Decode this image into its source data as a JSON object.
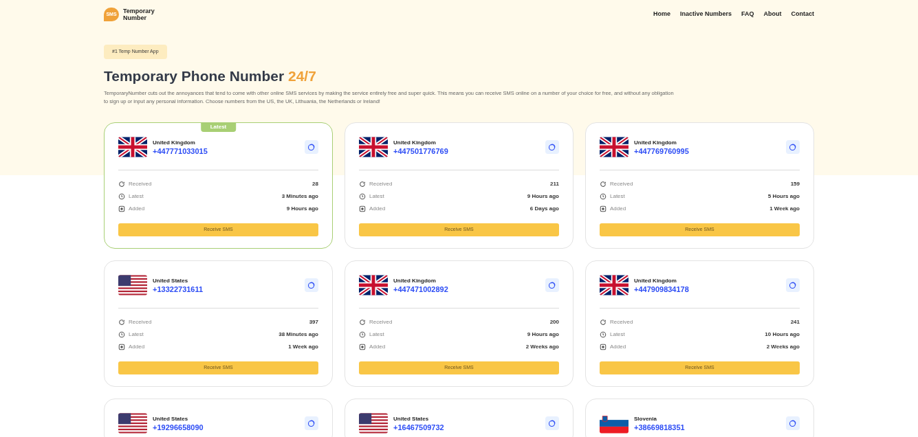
{
  "brand": {
    "logo_text": "SMS",
    "name": "Temporary Number"
  },
  "nav": [
    "Home",
    "Inactive Numbers",
    "FAQ",
    "About",
    "Contact"
  ],
  "hero": {
    "tag": "#1 Temp Number App",
    "title": "Temporary Phone Number",
    "title_accent": "24/7",
    "description": "TemporaryNumber cuts out the annoyances that tend to come with other online SMS services by making the service entirely free and super quick. This means you can receive SMS online on a number of your choice for free, and without any obligation to sign up or input any personal information. Choose numbers from the US, the UK, Lithuania, the Netherlands or Ireland!"
  },
  "cards": [
    {
      "kind": "uk",
      "country": "United Kingdom",
      "number": "+447771033015",
      "highlighted": true,
      "badge": "Latest",
      "stats": [
        {
          "kind": "received",
          "label": "Received",
          "value": "28"
        },
        {
          "kind": "latest",
          "label": "Latest",
          "value": "3 Minutes ago"
        },
        {
          "kind": "added",
          "label": "Added",
          "value": "9 Hours ago"
        }
      ],
      "button": "Receive SMS"
    },
    {
      "kind": "uk",
      "country": "United Kingdom",
      "number": "+447501776769",
      "highlighted": false,
      "stats": [
        {
          "kind": "received",
          "label": "Received",
          "value": "211"
        },
        {
          "kind": "latest",
          "label": "Latest",
          "value": "9 Hours ago"
        },
        {
          "kind": "added",
          "label": "Added",
          "value": "6 Days ago"
        }
      ],
      "button": "Receive SMS"
    },
    {
      "kind": "uk",
      "country": "United Kingdom",
      "number": "+447769760995",
      "highlighted": false,
      "stats": [
        {
          "kind": "received",
          "label": "Received",
          "value": "159"
        },
        {
          "kind": "latest",
          "label": "Latest",
          "value": "5 Hours ago"
        },
        {
          "kind": "added",
          "label": "Added",
          "value": "1 Week ago"
        }
      ],
      "button": "Receive SMS"
    },
    {
      "kind": "us",
      "country": "United States",
      "number": "+13322731611",
      "highlighted": false,
      "stats": [
        {
          "kind": "received",
          "label": "Received",
          "value": "397"
        },
        {
          "kind": "latest",
          "label": "Latest",
          "value": "38 Minutes ago"
        },
        {
          "kind": "added",
          "label": "Added",
          "value": "1 Week ago"
        }
      ],
      "button": "Receive SMS"
    },
    {
      "kind": "uk",
      "country": "United Kingdom",
      "number": "+447471002892",
      "highlighted": false,
      "stats": [
        {
          "kind": "received",
          "label": "Received",
          "value": "200"
        },
        {
          "kind": "latest",
          "label": "Latest",
          "value": "9 Hours ago"
        },
        {
          "kind": "added",
          "label": "Added",
          "value": "2 Weeks ago"
        }
      ],
      "button": "Receive SMS"
    },
    {
      "kind": "uk",
      "country": "United Kingdom",
      "number": "+447909834178",
      "highlighted": false,
      "stats": [
        {
          "kind": "received",
          "label": "Received",
          "value": "241"
        },
        {
          "kind": "latest",
          "label": "Latest",
          "value": "10 Hours ago"
        },
        {
          "kind": "added",
          "label": "Added",
          "value": "2 Weeks ago"
        }
      ],
      "button": "Receive SMS"
    },
    {
      "kind": "us",
      "country": "United States",
      "number": "+19296658090",
      "highlighted": false
    },
    {
      "kind": "us",
      "country": "United States",
      "number": "+16467509732",
      "highlighted": false
    },
    {
      "kind": "si",
      "country": "Slovenia",
      "number": "+38669818351",
      "highlighted": false
    }
  ]
}
